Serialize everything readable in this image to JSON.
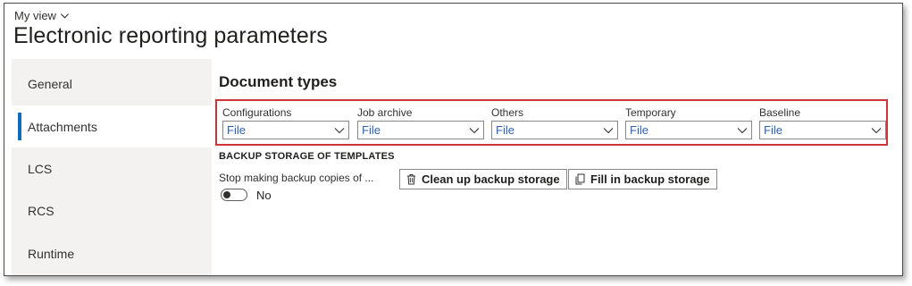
{
  "header": {
    "view_label": "My view",
    "page_title": "Electronic reporting parameters"
  },
  "sidebar": {
    "items": [
      {
        "label": "General"
      },
      {
        "label": "Attachments",
        "active": true
      },
      {
        "label": "LCS"
      },
      {
        "label": "RCS"
      },
      {
        "label": "Runtime"
      }
    ]
  },
  "main": {
    "section_title": "Document types",
    "document_types": [
      {
        "label": "Configurations",
        "value": "File"
      },
      {
        "label": "Job archive",
        "value": "File"
      },
      {
        "label": "Others",
        "value": "File"
      },
      {
        "label": "Temporary",
        "value": "File"
      },
      {
        "label": "Baseline",
        "value": "File"
      }
    ],
    "backup": {
      "heading": "BACKUP STORAGE OF TEMPLATES",
      "stop_label": "Stop making backup copies of ...",
      "toggle_value": "No",
      "clean_button": "Clean up backup storage",
      "fill_button": "Fill in backup storage"
    }
  },
  "colors": {
    "accent": "#0f6cbd",
    "highlight_border": "#d13438",
    "select_value": "#2b5fb8"
  },
  "icons": [
    "chevron-down-icon",
    "trash-icon",
    "copy-icon"
  ]
}
